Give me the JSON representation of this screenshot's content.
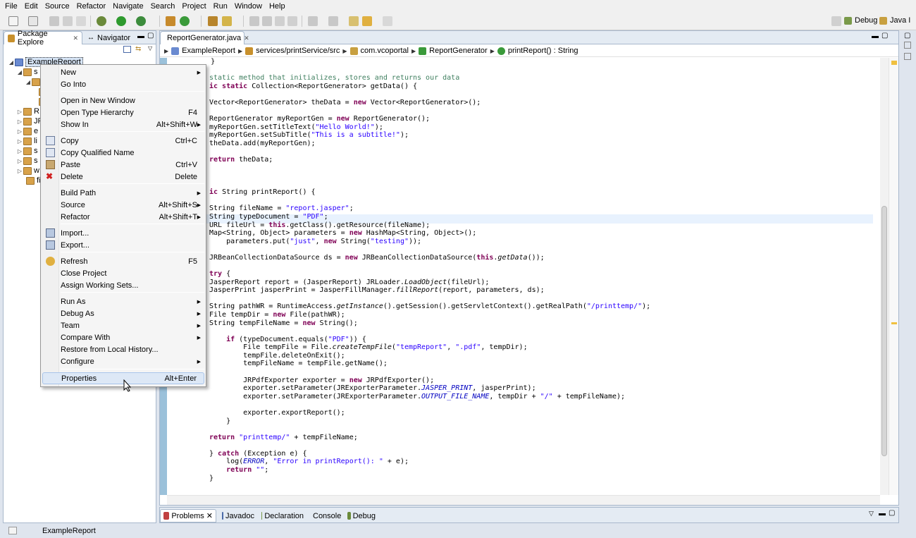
{
  "menubar": [
    "File",
    "Edit",
    "Source",
    "Refactor",
    "Navigate",
    "Search",
    "Project",
    "Run",
    "Window",
    "Help"
  ],
  "perspectives": {
    "debug": "Debug",
    "java": "Java I"
  },
  "left_view": {
    "tab_package": "Package Explore",
    "tab_navigator": "Navigator",
    "project_name": "ExampleReport",
    "tree_stub_labels": [
      "s",
      "",
      "",
      "",
      "R",
      "JR",
      "e",
      "li",
      "s",
      "s",
      "w",
      "fi"
    ]
  },
  "editor": {
    "tab_title": "ReportGenerator.java",
    "breadcrumb": [
      "ExampleReport",
      "services/printService/src",
      "com.vcoportal",
      "ReportGenerator",
      "printReport() : String"
    ],
    "colors": {
      "keyword": "#7f0055",
      "string": "#2a00ff",
      "comment": "#3f7f5f",
      "ruler": "#9bc1da"
    }
  },
  "bottom_tabs": [
    "Problems",
    "Javadoc",
    "Declaration",
    "Console",
    "Debug"
  ],
  "status": {
    "selection": "ExampleReport"
  },
  "context_menu": [
    {
      "label": "New",
      "accel": "",
      "submenu": true,
      "icon": ""
    },
    {
      "label": "Go Into",
      "accel": "",
      "submenu": false,
      "icon": ""
    },
    {
      "label": "Open in New Window",
      "accel": "",
      "submenu": false,
      "icon": ""
    },
    {
      "label": "Open Type Hierarchy",
      "accel": "F4",
      "submenu": false,
      "icon": ""
    },
    {
      "label": "Show In",
      "accel": "Alt+Shift+W",
      "submenu": true,
      "icon": ""
    },
    {
      "label": "Copy",
      "accel": "Ctrl+C",
      "submenu": false,
      "icon": "copy-icon"
    },
    {
      "label": "Copy Qualified Name",
      "accel": "",
      "submenu": false,
      "icon": "copy-qualified-icon"
    },
    {
      "label": "Paste",
      "accel": "Ctrl+V",
      "submenu": false,
      "icon": "paste-icon"
    },
    {
      "label": "Delete",
      "accel": "Delete",
      "submenu": false,
      "icon": "delete-icon"
    },
    {
      "label": "Build Path",
      "accel": "",
      "submenu": true,
      "icon": ""
    },
    {
      "label": "Source",
      "accel": "Alt+Shift+S",
      "submenu": true,
      "icon": ""
    },
    {
      "label": "Refactor",
      "accel": "Alt+Shift+T",
      "submenu": true,
      "icon": ""
    },
    {
      "label": "Import...",
      "accel": "",
      "submenu": false,
      "icon": "import-icon"
    },
    {
      "label": "Export...",
      "accel": "",
      "submenu": false,
      "icon": "export-icon"
    },
    {
      "label": "Refresh",
      "accel": "F5",
      "submenu": false,
      "icon": "refresh-icon"
    },
    {
      "label": "Close Project",
      "accel": "",
      "submenu": false,
      "icon": ""
    },
    {
      "label": "Assign Working Sets...",
      "accel": "",
      "submenu": false,
      "icon": ""
    },
    {
      "label": "Run As",
      "accel": "",
      "submenu": true,
      "icon": ""
    },
    {
      "label": "Debug As",
      "accel": "",
      "submenu": true,
      "icon": ""
    },
    {
      "label": "Team",
      "accel": "",
      "submenu": true,
      "icon": ""
    },
    {
      "label": "Compare With",
      "accel": "",
      "submenu": true,
      "icon": ""
    },
    {
      "label": "Restore from Local History...",
      "accel": "",
      "submenu": false,
      "icon": ""
    },
    {
      "label": "Configure",
      "accel": "",
      "submenu": true,
      "icon": ""
    },
    {
      "label": "Properties",
      "accel": "Alt+Enter",
      "submenu": false,
      "icon": ""
    }
  ],
  "code_lines": [
    [
      [
        "p",
        "    }"
      ]
    ],
    [
      [
        "p",
        ""
      ]
    ],
    [
      [
        "c",
        "static method that initializes, stores and returns our data"
      ]
    ],
    [
      [
        "k",
        "ic static"
      ],
      [
        "p",
        " Collection<ReportGenerator> getData() {"
      ]
    ],
    [
      [
        "p",
        ""
      ]
    ],
    [
      [
        "p",
        "Vector<ReportGenerator> theData = "
      ],
      [
        "k",
        "new"
      ],
      [
        "p",
        " Vector<ReportGenerator>();"
      ]
    ],
    [
      [
        "p",
        ""
      ]
    ],
    [
      [
        "p",
        "ReportGenerator myReportGen = "
      ],
      [
        "k",
        "new"
      ],
      [
        "p",
        " ReportGenerator();"
      ]
    ],
    [
      [
        "p",
        "myReportGen.setTitleText("
      ],
      [
        "s",
        "\"Hello World!\""
      ],
      [
        "p",
        ");"
      ]
    ],
    [
      [
        "p",
        "myReportGen.setSubTitle("
      ],
      [
        "s",
        "\"This is a subtitle!\""
      ],
      [
        "p",
        ");"
      ]
    ],
    [
      [
        "p",
        "theData.add(myReportGen);"
      ]
    ],
    [
      [
        "p",
        ""
      ]
    ],
    [
      [
        "k",
        "return"
      ],
      [
        "p",
        " theData;"
      ]
    ],
    [
      [
        "p",
        ""
      ]
    ],
    [
      [
        "p",
        ""
      ]
    ],
    [
      [
        "p",
        ""
      ]
    ],
    [
      [
        "k",
        "ic"
      ],
      [
        "p",
        " String printReport() {"
      ]
    ],
    [
      [
        "p",
        ""
      ]
    ],
    [
      [
        "p",
        "String fileName = "
      ],
      [
        "s",
        "\"report.jasper\""
      ],
      [
        "p",
        ";"
      ]
    ],
    [
      [
        "p",
        "String typeDocument = "
      ],
      [
        "s",
        "\"PDF\""
      ],
      [
        "p",
        ";"
      ]
    ],
    [
      [
        "p",
        "URL fileUrl = "
      ],
      [
        "k",
        "this"
      ],
      [
        "p",
        ".getClass().getResource(fileName);"
      ]
    ],
    [
      [
        "p",
        "Map<String, Object> parameters = "
      ],
      [
        "k",
        "new"
      ],
      [
        "p",
        " HashMap<String, Object>();"
      ]
    ],
    [
      [
        "p",
        "    parameters.put("
      ],
      [
        "s",
        "\"just\""
      ],
      [
        "p",
        ", "
      ],
      [
        "k",
        "new"
      ],
      [
        "p",
        " String("
      ],
      [
        "s",
        "\"testing\""
      ],
      [
        "p",
        "));"
      ]
    ],
    [
      [
        "p",
        ""
      ]
    ],
    [
      [
        "p",
        "JRBeanCollectionDataSource ds = "
      ],
      [
        "k",
        "new"
      ],
      [
        "p",
        " JRBeanCollectionDataSource("
      ],
      [
        "k",
        "this"
      ],
      [
        "p",
        "."
      ],
      [
        "i",
        "getData"
      ],
      [
        "p",
        "());"
      ]
    ],
    [
      [
        "p",
        ""
      ]
    ],
    [
      [
        "k",
        "try"
      ],
      [
        "p",
        " {"
      ]
    ],
    [
      [
        "p",
        "JasperReport report = (JasperReport) JRLoader."
      ],
      [
        "i",
        "LoadObject"
      ],
      [
        "p",
        "(fileUrl);"
      ]
    ],
    [
      [
        "p",
        "JasperPrint jasperPrint = JasperFillManager."
      ],
      [
        "i",
        "fillReport"
      ],
      [
        "p",
        "(report, parameters, ds);"
      ]
    ],
    [
      [
        "p",
        ""
      ]
    ],
    [
      [
        "p",
        "String pathWR = RuntimeAccess."
      ],
      [
        "i",
        "getInstance"
      ],
      [
        "p",
        "().getSession().getServletContext().getRealPath("
      ],
      [
        "s",
        "\"/printtemp/\""
      ],
      [
        "p",
        ");"
      ]
    ],
    [
      [
        "p",
        "File tempDir = "
      ],
      [
        "k",
        "new"
      ],
      [
        "p",
        " File(pathWR);"
      ]
    ],
    [
      [
        "p",
        "String tempFileName = "
      ],
      [
        "k",
        "new"
      ],
      [
        "p",
        " String();"
      ]
    ],
    [
      [
        "p",
        ""
      ]
    ],
    [
      [
        "p",
        "    "
      ],
      [
        "k",
        "if"
      ],
      [
        "p",
        " (typeDocument.equals("
      ],
      [
        "s",
        "\"PDF\""
      ],
      [
        "p",
        ")) {"
      ]
    ],
    [
      [
        "p",
        "        File tempFile = File."
      ],
      [
        "i",
        "createTempFile"
      ],
      [
        "p",
        "("
      ],
      [
        "s",
        "\"tempReport\""
      ],
      [
        "p",
        ", "
      ],
      [
        "s",
        "\".pdf\""
      ],
      [
        "p",
        ", tempDir);"
      ]
    ],
    [
      [
        "p",
        "        tempFile.deleteOnExit();"
      ]
    ],
    [
      [
        "p",
        "        tempFileName = tempFile.getName();"
      ]
    ],
    [
      [
        "p",
        ""
      ]
    ],
    [
      [
        "p",
        "        JRPdfExporter exporter = "
      ],
      [
        "k",
        "new"
      ],
      [
        "p",
        " JRPdfExporter();"
      ]
    ],
    [
      [
        "p",
        "        exporter.setParameter(JRExporterParameter."
      ],
      [
        "b",
        "JASPER_PRINT"
      ],
      [
        "p",
        ", jasperPrint);"
      ]
    ],
    [
      [
        "p",
        "        exporter.setParameter(JRExporterParameter."
      ],
      [
        "b",
        "OUTPUT_FILE_NAME"
      ],
      [
        "p",
        ", tempDir + "
      ],
      [
        "s",
        "\"/\""
      ],
      [
        "p",
        " + tempFileName);"
      ]
    ],
    [
      [
        "p",
        ""
      ]
    ],
    [
      [
        "p",
        "        exporter.exportReport();"
      ]
    ],
    [
      [
        "p",
        "    }"
      ]
    ],
    [
      [
        "p",
        ""
      ]
    ],
    [
      [
        "k",
        "return"
      ],
      [
        "p",
        " "
      ],
      [
        "s",
        "\"printtemp/\""
      ],
      [
        "p",
        " + tempFileName;"
      ]
    ],
    [
      [
        "p",
        ""
      ]
    ],
    [
      [
        "p",
        "} "
      ],
      [
        "k",
        "catch"
      ],
      [
        "p",
        " (Exception e) {"
      ]
    ],
    [
      [
        "p",
        "    log("
      ],
      [
        "b",
        "ERROR"
      ],
      [
        "p",
        ", "
      ],
      [
        "s",
        "\"Error in printReport(): \""
      ],
      [
        "p",
        " + e);"
      ]
    ],
    [
      [
        "p",
        "    "
      ],
      [
        "k",
        "return"
      ],
      [
        "p",
        " "
      ],
      [
        "s",
        "\"\""
      ],
      [
        "p",
        ";"
      ]
    ],
    [
      [
        "p",
        "}"
      ]
    ]
  ]
}
